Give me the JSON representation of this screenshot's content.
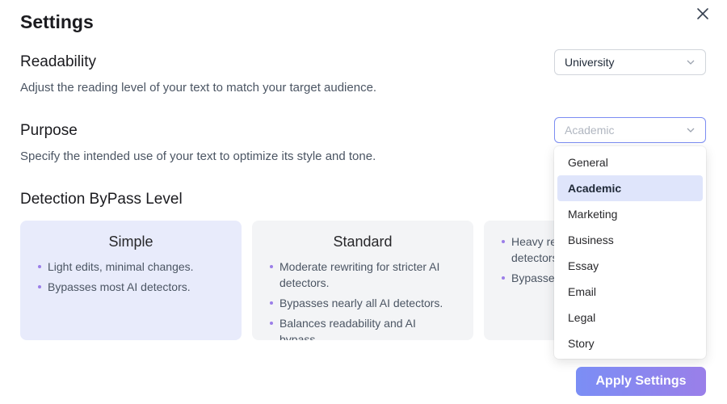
{
  "title": "Settings",
  "close_icon": "close-icon",
  "readability": {
    "title": "Readability",
    "description": "Adjust the reading level of your text to match your target audience.",
    "selected": "University"
  },
  "purpose": {
    "title": "Purpose",
    "description": "Specify the intended use of your text to optimize its style and tone.",
    "placeholder": "Academic",
    "options": [
      "General",
      "Academic",
      "Marketing",
      "Business",
      "Essay",
      "Email",
      "Legal",
      "Story"
    ],
    "highlighted": "Academic"
  },
  "bypass": {
    "title": "Detection ByPass Level",
    "cards": [
      {
        "title": "Simple",
        "bullets": [
          "Light edits, minimal changes.",
          "Bypasses most AI detectors."
        ]
      },
      {
        "title": "Standard",
        "bullets": [
          "Moderate rewriting for stricter AI detectors.",
          "Bypasses nearly all AI detectors.",
          "Balances readability and AI bypass."
        ]
      },
      {
        "title": "",
        "bullets": [
          "Heavy rew",
          "detectors.",
          "Bypasses"
        ]
      }
    ]
  },
  "apply_label": "Apply Settings",
  "colors": {
    "accent_start": "#7b8ef5",
    "accent_end": "#9a7fe9",
    "selected_card": "#e8ebfb",
    "highlight": "#dfe5fb"
  }
}
